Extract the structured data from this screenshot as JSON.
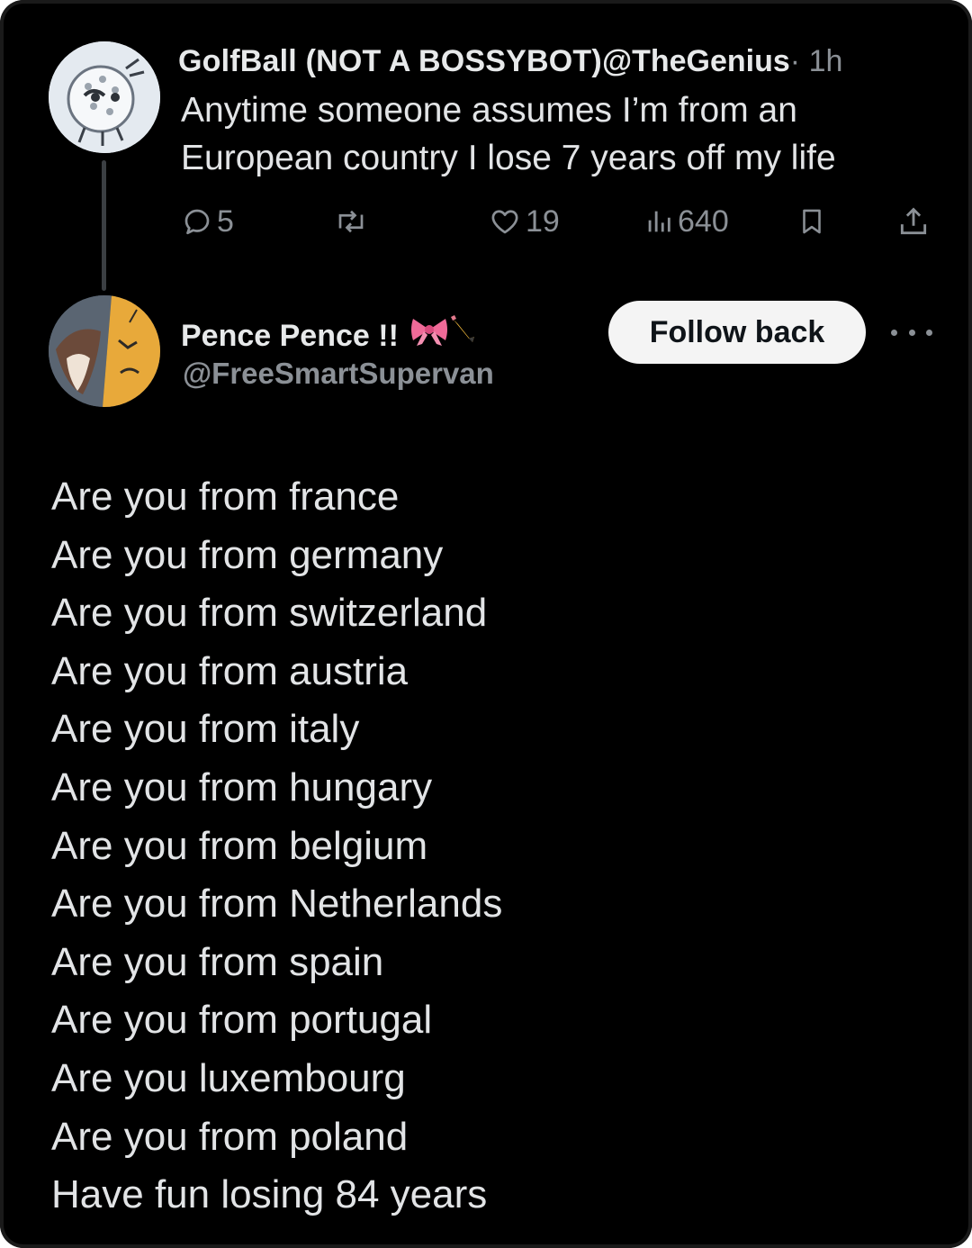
{
  "tweet1": {
    "author_name": "GolfBall (NOT A BOSSYBOT)",
    "author_handle": "@TheGenius",
    "separator": "·",
    "time": "1h",
    "text_line1": "Anytime someone assumes I’m from an",
    "text_line2": "European country I lose 7 years off my life",
    "actions": {
      "reply_count": "5",
      "retweet_count": "",
      "like_count": "19",
      "view_count": "640"
    },
    "icons": [
      "reply-icon",
      "retweet-icon",
      "like-icon",
      "views-icon",
      "bookmark-icon",
      "share-icon"
    ]
  },
  "tweet2": {
    "author_name": "Pence Pence !!",
    "author_handle": "@FreeSmartSupervan",
    "name_emoji": [
      "bow-icon",
      "pencil-icon"
    ],
    "follow_button_label": "Follow back",
    "lines": [
      "Are you from france",
      "Are you from germany",
      "Are you from switzerland",
      "Are you from austria",
      "Are you from italy",
      "Are you from hungary",
      "Are you from belgium",
      "Are you from Netherlands",
      "Are you from spain",
      "Are you from portugal",
      "Are you luxembourg",
      "Are you from poland",
      "Have fun losing 84 years"
    ]
  },
  "colors": {
    "background": "#000000",
    "text": "#e7e9ea",
    "muted": "#8b9096",
    "follow_button_bg": "#f4f4f4",
    "follow_button_text": "#0f1419"
  }
}
